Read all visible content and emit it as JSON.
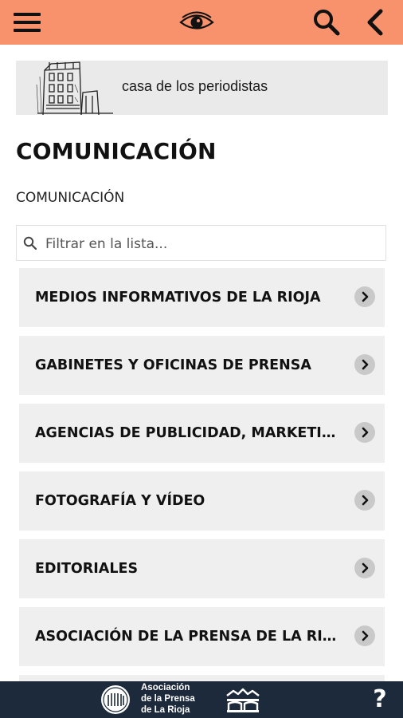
{
  "header": {
    "icons": [
      "hamburger-menu-icon",
      "eye-icon",
      "search-icon",
      "back-arrow-icon"
    ],
    "background_color": "#f7926c"
  },
  "banner": {
    "text": "casa de los periodistas"
  },
  "page": {
    "title": "COMUNICACIÓN",
    "subtitle": "COMUNICACIÓN"
  },
  "filter": {
    "placeholder": "Filtrar en la lista...",
    "value": ""
  },
  "list": {
    "items": [
      {
        "label": "MEDIOS INFORMATIVOS DE LA RIOJA"
      },
      {
        "label": "GABINETES Y OFICINAS DE PRENSA"
      },
      {
        "label": "AGENCIAS DE PUBLICIDAD, MARKETING Y COMUNICACIÓN"
      },
      {
        "label": "FOTOGRAFÍA Y VÍDEO"
      },
      {
        "label": "EDITORIALES"
      },
      {
        "label": "ASOCIACIÓN DE LA PRENSA DE LA RIOJA"
      }
    ]
  },
  "footer": {
    "logo_lines": [
      "Asociación",
      "de la Prensa",
      "de La Rioja"
    ],
    "help_label": "?",
    "background_color": "#1c2a3c"
  }
}
